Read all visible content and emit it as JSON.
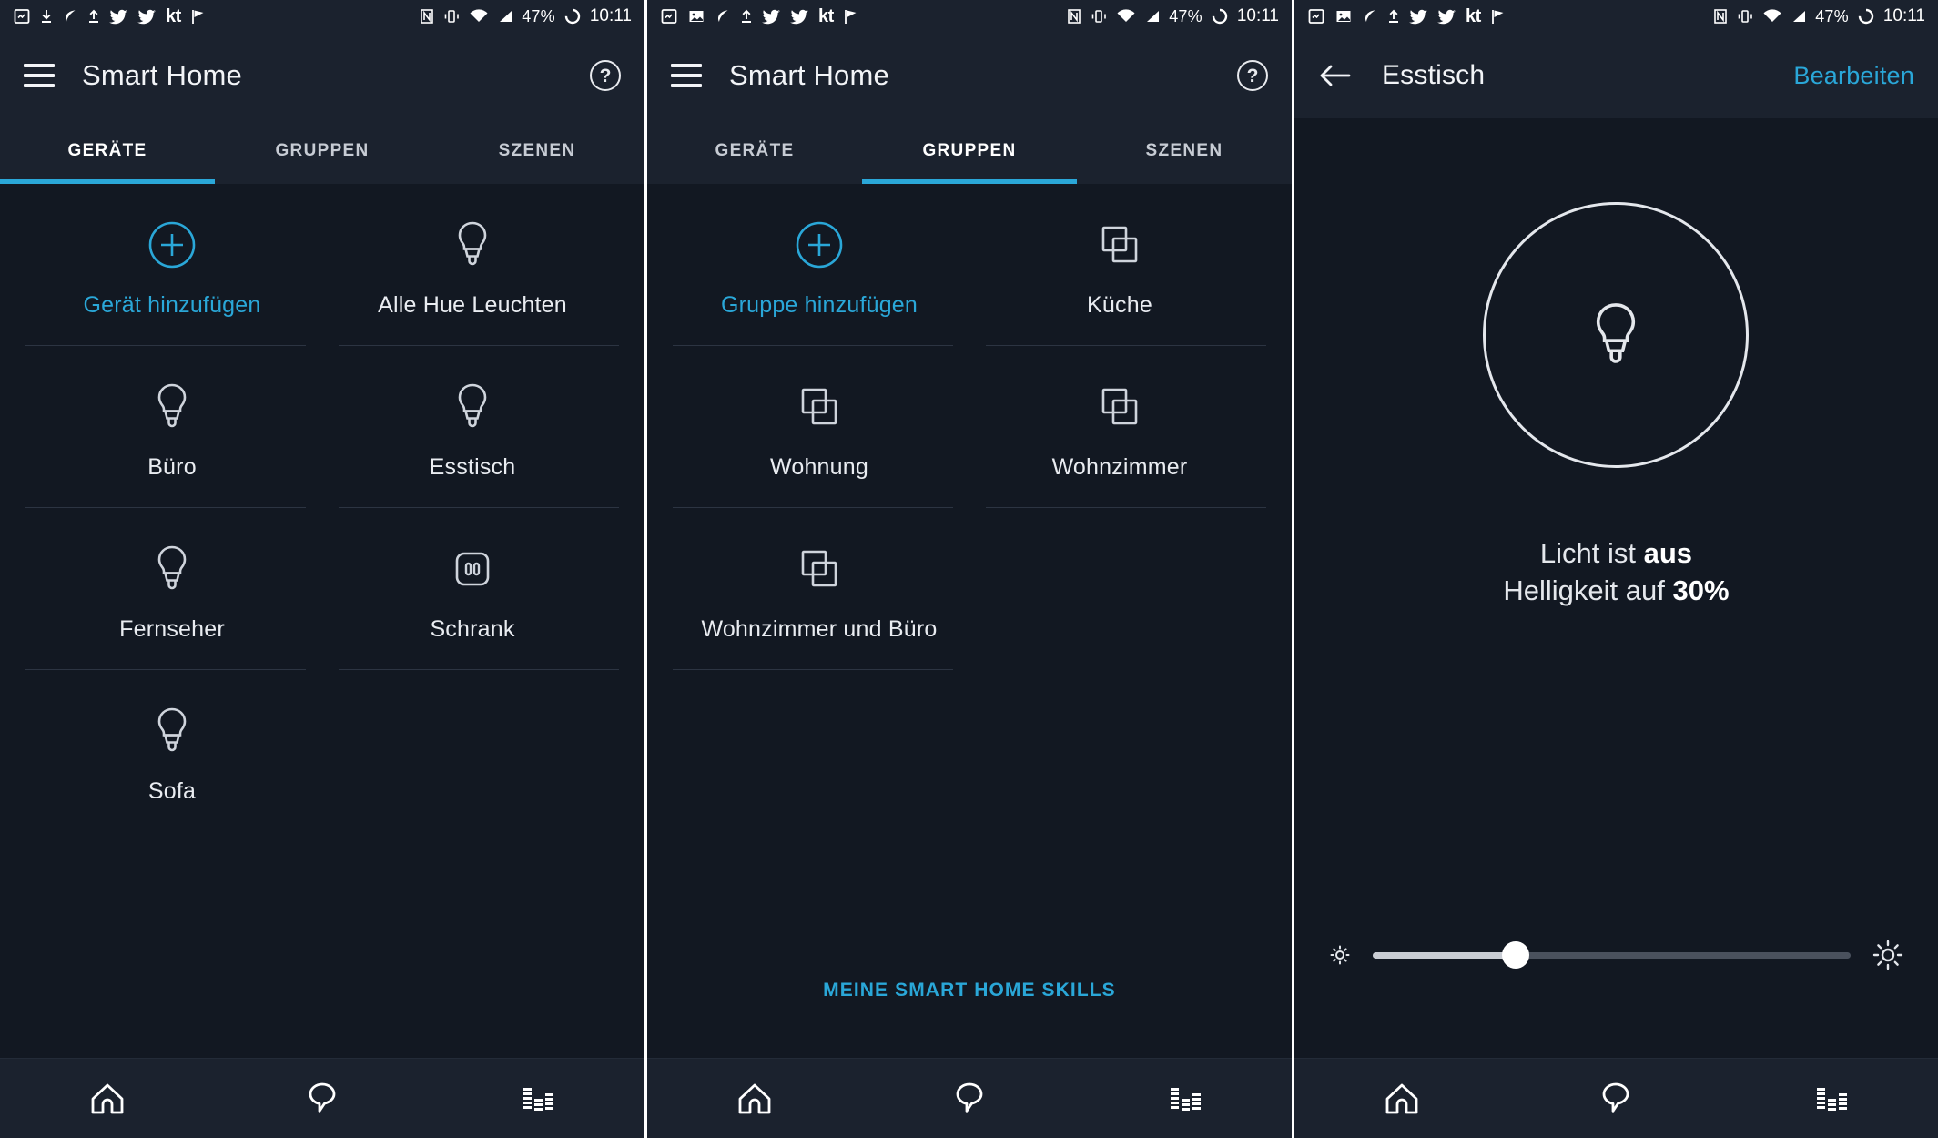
{
  "statusbar": {
    "icons_left": [
      "photo-icon",
      "download-icon",
      "leaf-icon",
      "upload-icon",
      "twitter-icon",
      "twitter-icon",
      "kt-icon",
      "checkmark-flag-icon"
    ],
    "kt_label": "kt",
    "icons_right": [
      "nfc-icon",
      "vibrate-icon",
      "wifi-icon",
      "signal-icon"
    ],
    "battery": "47%",
    "battery_ring_icon": "battery-ring-icon",
    "time": "10:11"
  },
  "colors": {
    "accent": "#2aa7d8",
    "bg": "#121822",
    "bar_bg": "#1b222e",
    "text": "#e9ecf1",
    "divider": "#2c3442"
  },
  "panel1": {
    "appbar": {
      "menu_icon": "hamburger-icon",
      "title": "Smart Home",
      "help_icon": "help-icon",
      "help_label": "?"
    },
    "tabs": {
      "items": [
        "GERÄTE",
        "GRUPPEN",
        "SZENEN"
      ],
      "active_index": 0
    },
    "grid": [
      {
        "label": "Gerät hinzufügen",
        "icon": "plus-circle-icon",
        "accent": true
      },
      {
        "label": "Alle Hue Leuchten",
        "icon": "bulb-icon",
        "accent": false
      },
      {
        "label": "Büro",
        "icon": "bulb-icon",
        "accent": false
      },
      {
        "label": "Esstisch",
        "icon": "bulb-icon",
        "accent": false
      },
      {
        "label": "Fernseher",
        "icon": "bulb-icon",
        "accent": false
      },
      {
        "label": "Schrank",
        "icon": "outlet-icon",
        "accent": false
      },
      {
        "label": "Sofa",
        "icon": "bulb-icon",
        "accent": false
      }
    ]
  },
  "panel2": {
    "appbar": {
      "menu_icon": "hamburger-icon",
      "title": "Smart Home",
      "help_icon": "help-icon",
      "help_label": "?"
    },
    "tabs": {
      "items": [
        "GERÄTE",
        "GRUPPEN",
        "SZENEN"
      ],
      "active_index": 1
    },
    "grid": [
      {
        "label": "Gruppe hinzufügen",
        "icon": "plus-circle-icon",
        "accent": true
      },
      {
        "label": "Küche",
        "icon": "group-squares-icon",
        "accent": false
      },
      {
        "label": "Wohnung",
        "icon": "group-squares-icon",
        "accent": false
      },
      {
        "label": "Wohnzimmer",
        "icon": "group-squares-icon",
        "accent": false
      },
      {
        "label": "Wohnzimmer und Büro",
        "icon": "group-squares-icon",
        "accent": false
      }
    ],
    "skills_link": "MEINE SMART HOME SKILLS"
  },
  "panel3": {
    "appbar": {
      "back_icon": "back-arrow-icon",
      "title": "Esstisch",
      "edit_label": "Bearbeiten"
    },
    "device": {
      "icon": "bulb-icon",
      "power_prefix": "Licht ist ",
      "power_state": "aus",
      "brightness_prefix": "Helligkeit auf ",
      "brightness_value": "30%",
      "brightness_percent": 30,
      "slider_low_icon": "brightness-low-icon",
      "slider_high_icon": "brightness-high-icon"
    }
  },
  "bottomnav": {
    "items": [
      {
        "icon": "home-icon",
        "name": "nav-home"
      },
      {
        "icon": "chat-bubble-icon",
        "name": "nav-conversations"
      },
      {
        "icon": "equalizer-icon",
        "name": "nav-activity"
      }
    ]
  }
}
